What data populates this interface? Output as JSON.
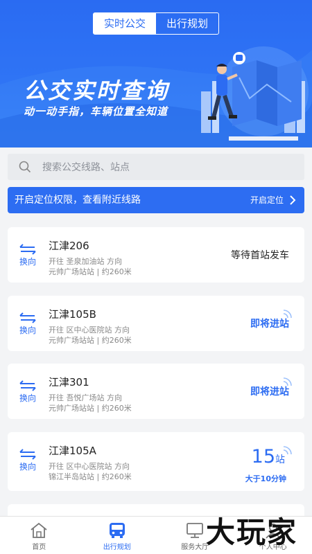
{
  "header": {
    "tabs": [
      {
        "label": "实时公交",
        "active": true
      },
      {
        "label": "出行规划",
        "active": false
      }
    ]
  },
  "banner": {
    "title": "公交实时查询",
    "subtitle": "动一动手指，车辆位置全知道"
  },
  "search": {
    "placeholder": "搜索公交线路、站点",
    "value": ""
  },
  "location_bar": {
    "text": "开启定位权限，查看附近线路",
    "button": "开启定位"
  },
  "swap_label": "换向",
  "routes": [
    {
      "name": "江津206",
      "direction": "开往 圣泉加油站 方向",
      "stop": "元帅广场站站 | 约260米",
      "status": "等待首站发车"
    },
    {
      "name": "江津105B",
      "direction": "开往 区中心医院站 方向",
      "stop": "元帅广场站站 | 约260米",
      "status": "即将进站"
    },
    {
      "name": "江津301",
      "direction": "开往 吾悦广场站 方向",
      "stop": "元帅广场站站 | 约260米",
      "status": "即将进站"
    },
    {
      "name": "江津105A",
      "direction": "开往 区中心医院站 方向",
      "stop": "锦江半岛站站 | 约260米",
      "stops_away": "15",
      "stops_unit": "站",
      "eta": "大于10分钟"
    }
  ],
  "bottom_nav": [
    {
      "label": "首页",
      "icon": "home-icon",
      "active": false
    },
    {
      "label": "出行规划",
      "icon": "bus-icon",
      "active": true
    },
    {
      "label": "服务大厅",
      "icon": "monitor-icon",
      "active": false
    },
    {
      "label": "个人中心",
      "icon": "person-icon",
      "active": false
    }
  ],
  "watermark": "大玩家",
  "colors": {
    "primary": "#2c6cf2",
    "background": "#f3f4f6"
  }
}
